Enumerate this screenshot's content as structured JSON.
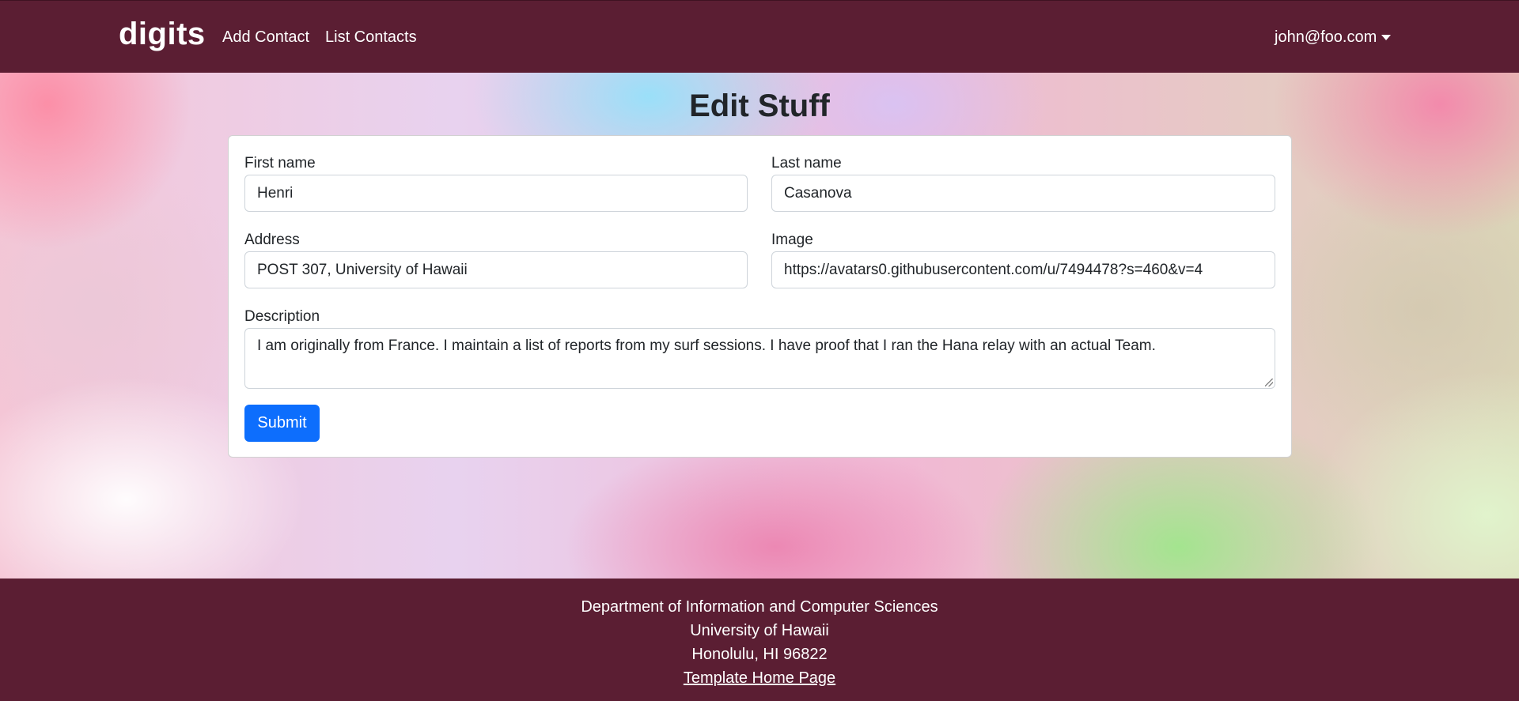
{
  "navbar": {
    "brand": "digits",
    "links": [
      {
        "label": "Add Contact"
      },
      {
        "label": "List Contacts"
      }
    ],
    "user": "john@foo.com"
  },
  "page": {
    "title": "Edit Stuff"
  },
  "form": {
    "first_name": {
      "label": "First name",
      "value": "Henri"
    },
    "last_name": {
      "label": "Last name",
      "value": "Casanova"
    },
    "address": {
      "label": "Address",
      "value": "POST 307, University of Hawaii"
    },
    "image": {
      "label": "Image",
      "value": "https://avatars0.githubusercontent.com/u/7494478?s=460&v=4"
    },
    "description": {
      "label": "Description",
      "value": "I am originally from France. I maintain a list of reports from my surf sessions. I have proof that I ran the Hana relay with an actual Team."
    },
    "submit_label": "Submit"
  },
  "footer": {
    "lines": [
      "Department of Information and Computer Sciences",
      "University of Hawaii",
      "Honolulu, HI 96822"
    ],
    "link": "Template Home Page"
  },
  "colors": {
    "navbar_bg": "#5b1e33",
    "primary_button": "#0d6efd"
  },
  "icons": {
    "user_menu": "caret-down-icon"
  }
}
